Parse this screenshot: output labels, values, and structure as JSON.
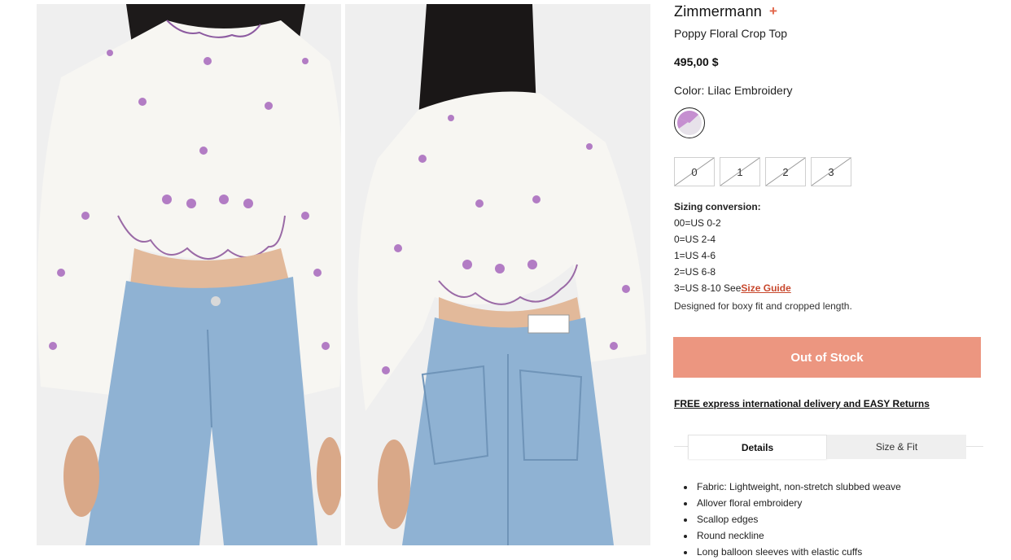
{
  "images": [
    {
      "name": "front-view",
      "alt_icon": "product-photo-front"
    },
    {
      "name": "back-view",
      "alt_icon": "product-photo-back"
    }
  ],
  "product": {
    "brand": "Zimmermann",
    "favorite_icon": "plus-icon",
    "name": "Poppy Floral Crop Top",
    "price": "495,00 $",
    "color_label": "Color: Lilac Embroidery",
    "swatch_color": "#c58fd0",
    "sizes": [
      "0",
      "1",
      "2",
      "3"
    ],
    "sizing_title": "Sizing conversion:",
    "sizing_lines": [
      "00=US 0-2",
      "0=US 2-4",
      "1=US 4-6",
      "2=US 6-8"
    ],
    "sizing_last": "3=US 8-10 See",
    "size_guide_label": "Size Guide",
    "fit_note": "Designed for boxy fit and cropped length.",
    "cta_label": "Out of Stock",
    "delivery_link": "FREE express international delivery and EASY Returns"
  },
  "tabs": [
    {
      "label": "Details",
      "active": true
    },
    {
      "label": "Size & Fit",
      "active": false
    }
  ],
  "details": [
    "Fabric: Lightweight, non-stretch slubbed weave",
    "Allover floral embroidery",
    "Scallop edges",
    "Round neckline",
    "Long balloon sleeves with elastic cuffs"
  ],
  "colors": {
    "accent": "#e2664a",
    "cta_bg": "#ec9680",
    "link_accent": "#c8482d"
  }
}
